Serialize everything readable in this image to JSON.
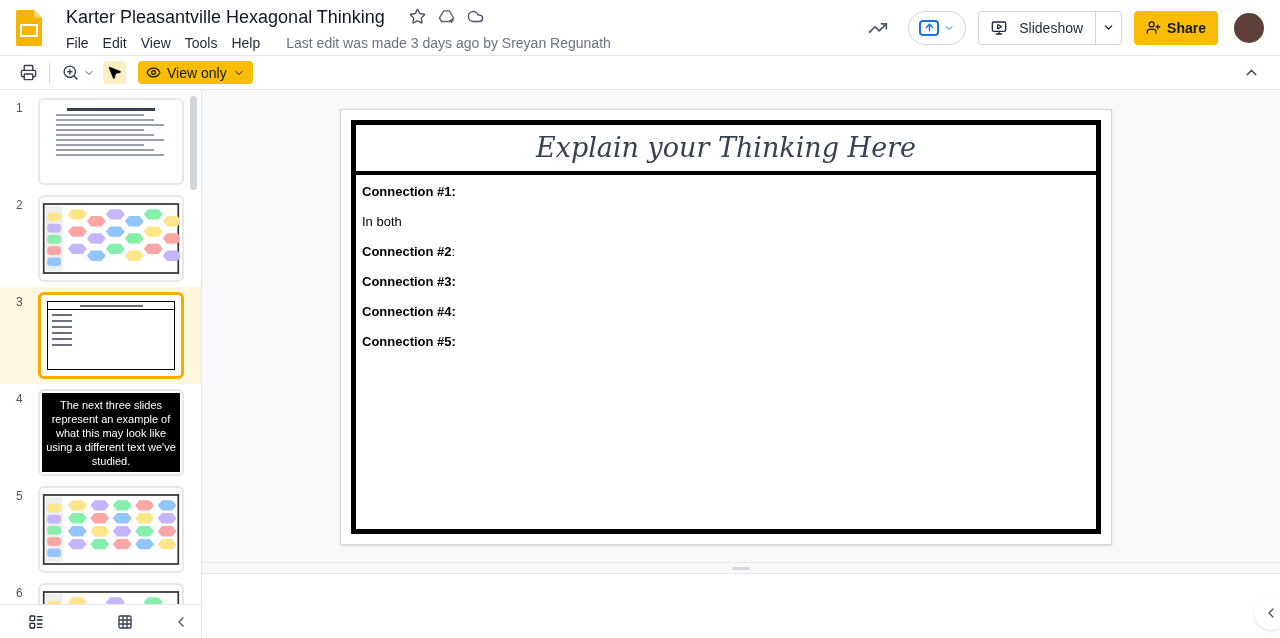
{
  "document": {
    "title": "Karter Pleasantville Hexagonal Thinking",
    "menu": [
      "File",
      "Edit",
      "View",
      "Tools",
      "Help"
    ],
    "last_edit": "Last edit was made 3 days ago by Sreyan Regunath"
  },
  "header_buttons": {
    "slideshow": "Slideshow",
    "share": "Share"
  },
  "toolbar": {
    "mode": "View only"
  },
  "slides": [
    {
      "number": "1",
      "kind": "instructions",
      "selected": false
    },
    {
      "number": "2",
      "kind": "hexagons",
      "selected": false
    },
    {
      "number": "3",
      "kind": "worksheet",
      "selected": true
    },
    {
      "number": "4",
      "kind": "message",
      "selected": false,
      "text": "The next three slides represent an example of what this may look like using a different text we've studied."
    },
    {
      "number": "5",
      "kind": "grid",
      "selected": false
    },
    {
      "number": "6",
      "kind": "hexagons",
      "selected": false
    }
  ],
  "current_slide": {
    "title": "Explain your Thinking Here",
    "lines": [
      {
        "text": "Connection #1:",
        "bold": true
      },
      {
        "text": "In both",
        "bold": false
      },
      {
        "text": "Connection #2",
        "bold": true,
        "suffix": ":"
      },
      {
        "text": "Connection #3:",
        "bold": true
      },
      {
        "text": "Connection #4:",
        "bold": true
      },
      {
        "text": "Connection #5:",
        "bold": true
      }
    ]
  }
}
